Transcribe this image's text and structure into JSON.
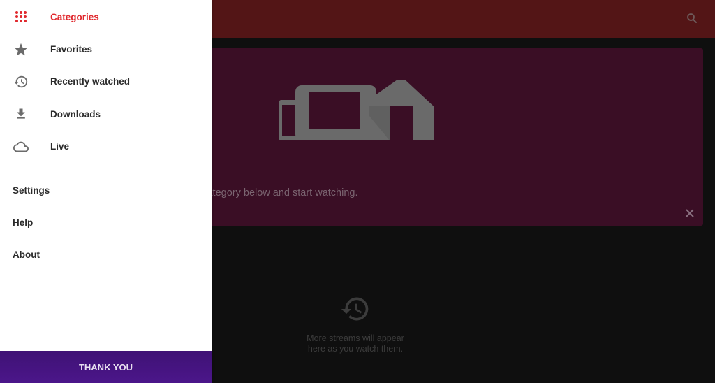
{
  "colors": {
    "accent": "#e0282d",
    "appbar": "#531516",
    "banner": "#3a0e25",
    "drawer_footer": "#4b168a"
  },
  "appbar": {
    "search_icon": "search-icon"
  },
  "banner": {
    "text": "...streams. Just pick a category below and start watching.",
    "close_icon": "close-icon",
    "illustration": "devices-illustration"
  },
  "empty_state": {
    "icon": "history-icon",
    "text_line1": "More streams will appear",
    "text_line2": "here as you watch them."
  },
  "drawer": {
    "primary_items": [
      {
        "label": "Categories",
        "icon": "apps-grid-icon",
        "active": true
      },
      {
        "label": "Favorites",
        "icon": "star-icon",
        "active": false
      },
      {
        "label": "Recently watched",
        "icon": "history-icon",
        "active": false
      },
      {
        "label": "Downloads",
        "icon": "download-icon",
        "active": false
      },
      {
        "label": "Live",
        "icon": "cloud-icon",
        "active": false
      }
    ],
    "secondary_items": [
      {
        "label": "Settings"
      },
      {
        "label": "Help"
      },
      {
        "label": "About"
      }
    ],
    "footer_button": "THANK YOU"
  }
}
